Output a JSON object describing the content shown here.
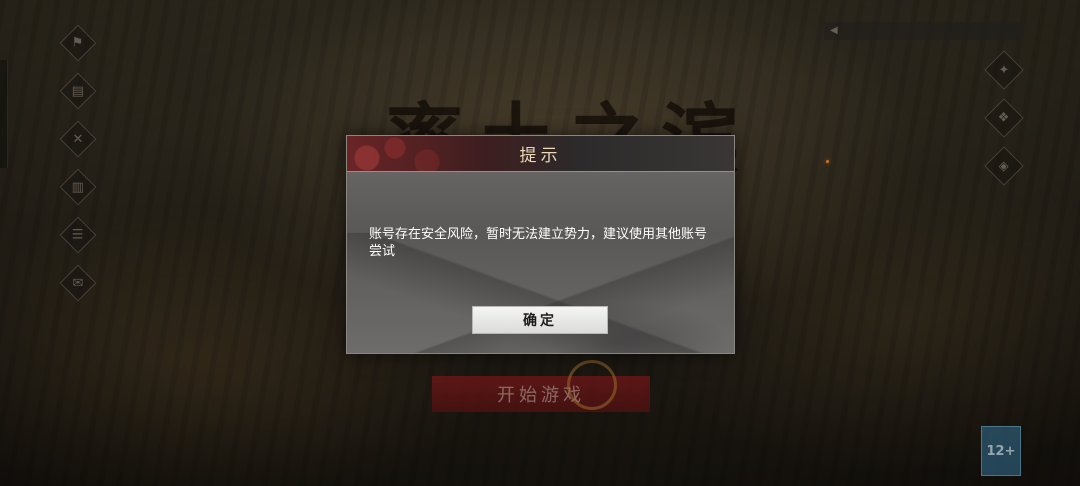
{
  "background": {
    "game_title": "率土之滨",
    "start_button_label": "开始游戏",
    "left_rail_icons": [
      "flag-icon",
      "notice-icon",
      "tools-icon",
      "book-icon",
      "scroll-icon",
      "chat-icon"
    ],
    "right_rail_icons": [
      "compass-icon",
      "gift-icon",
      "shield-icon"
    ],
    "age_badge": "12+",
    "colors": {
      "start_button": "#8c1e1e",
      "ember": "#ff8a2a"
    }
  },
  "dialog": {
    "title": "提示",
    "message": "账号存在安全风险，暂时无法建立势力，建议使用其他账号尝试",
    "confirm_label": "确定",
    "colors": {
      "header": "#6a2426",
      "body": "#5f5d5b",
      "title_text": "#e9d9b8",
      "message_text": "#ffffff",
      "button_bg": "#eeeeec"
    }
  }
}
